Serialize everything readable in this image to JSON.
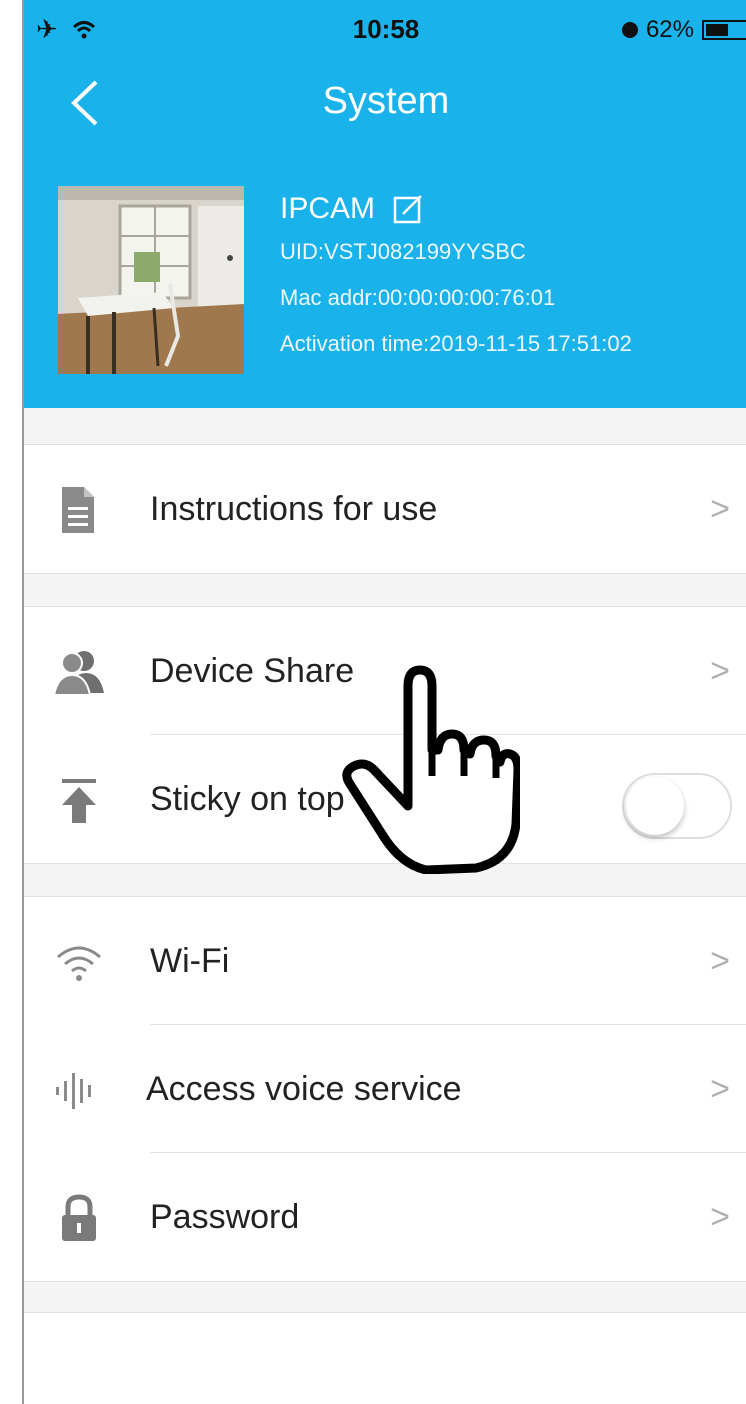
{
  "status_bar": {
    "time": "10:58",
    "battery": "62%"
  },
  "header": {
    "title": "System"
  },
  "device": {
    "name": "IPCAM",
    "uid": "UID:VSTJ082199YYSBC",
    "mac": "Mac addr:00:00:00:00:76:01",
    "activation": "Activation time:2019-11-15 17:51:02"
  },
  "menu": {
    "instructions": {
      "label": "Instructions for use",
      "icon": "document-icon"
    },
    "device_share": {
      "label": "Device Share",
      "icon": "users-icon"
    },
    "sticky": {
      "label": "Sticky on top",
      "icon": "pin-top-icon",
      "enabled": false
    },
    "wifi": {
      "label": "Wi-Fi",
      "icon": "wifi-icon"
    },
    "voice": {
      "label": "Access voice service",
      "icon": "voice-wave-icon"
    },
    "password": {
      "label": "Password",
      "icon": "lock-icon"
    },
    "chevron": ">"
  },
  "colors": {
    "header": "#1ab2ea",
    "background": "#f4f4f4"
  }
}
